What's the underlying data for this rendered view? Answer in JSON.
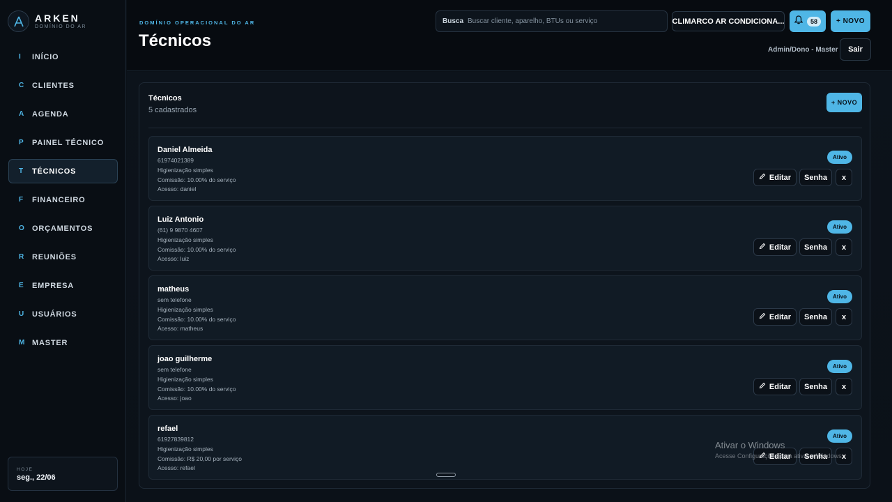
{
  "brand": {
    "name": "ARKEN",
    "tagline": "DOMÍNIO DO AR",
    "logo_letter": "A"
  },
  "sidebar": {
    "items": [
      {
        "letter": "I",
        "label": "INÍCIO"
      },
      {
        "letter": "C",
        "label": "CLIENTES"
      },
      {
        "letter": "A",
        "label": "AGENDA"
      },
      {
        "letter": "P",
        "label": "PAINEL TÉCNICO"
      },
      {
        "letter": "T",
        "label": "TÉCNICOS",
        "active": true
      },
      {
        "letter": "F",
        "label": "FINANCEIRO"
      },
      {
        "letter": "O",
        "label": "ORÇAMENTOS"
      },
      {
        "letter": "R",
        "label": "REUNIÕES"
      },
      {
        "letter": "E",
        "label": "EMPRESA"
      },
      {
        "letter": "U",
        "label": "USUÁRIOS"
      },
      {
        "letter": "M",
        "label": "MASTER"
      }
    ],
    "today_label": "HOJE",
    "today_value": "seg., 22/06"
  },
  "header": {
    "kicker": "DOMÍNIO OPERACIONAL DO AR",
    "title": "Técnicos",
    "search_label": "Busca",
    "search_placeholder": "Buscar cliente, aparelho, BTUs ou serviço",
    "company": "CLIMARCO AR CONDICIONA...",
    "notifications": "58",
    "new_label": "+ NOVO",
    "user_role": "Admin/Dono - Master",
    "logout": "Sair"
  },
  "panel": {
    "title": "Técnicos",
    "subtitle": "5 cadastrados",
    "new_label": "+ NOVO",
    "status_label": "Ativo",
    "edit_label": "Editar",
    "password_label": "Senha",
    "delete_label": "x",
    "technicians": [
      {
        "name": "Daniel Almeida",
        "phone": "61974021389",
        "service": "Higienização simples",
        "commission": "Comissão: 10.00% do serviço",
        "access": "Acesso: daniel"
      },
      {
        "name": "Luiz Antonio",
        "phone": "(61) 9 9870 4607",
        "service": "Higienização simples",
        "commission": "Comissão: 10.00% do serviço",
        "access": "Acesso: luiz"
      },
      {
        "name": "matheus",
        "phone": "sem telefone",
        "service": "Higienização simples",
        "commission": "Comissão: 10.00% do serviço",
        "access": "Acesso: matheus"
      },
      {
        "name": "joao guilherme",
        "phone": "sem telefone",
        "service": "Higienização simples",
        "commission": "Comissão: 10.00% do serviço",
        "access": "Acesso: joao"
      },
      {
        "name": "refael",
        "phone": "61927839812",
        "service": "Higienização simples",
        "commission": "Comissão: R$ 20,00 por serviço",
        "access": "Acesso: refael"
      }
    ]
  },
  "watermark": {
    "title": "Ativar o Windows",
    "subtitle": "Acesse Configurações para ativar o Windows."
  },
  "colors": {
    "accent": "#4fb6e6",
    "background": "#0b1118",
    "panel": "#0d141c"
  }
}
